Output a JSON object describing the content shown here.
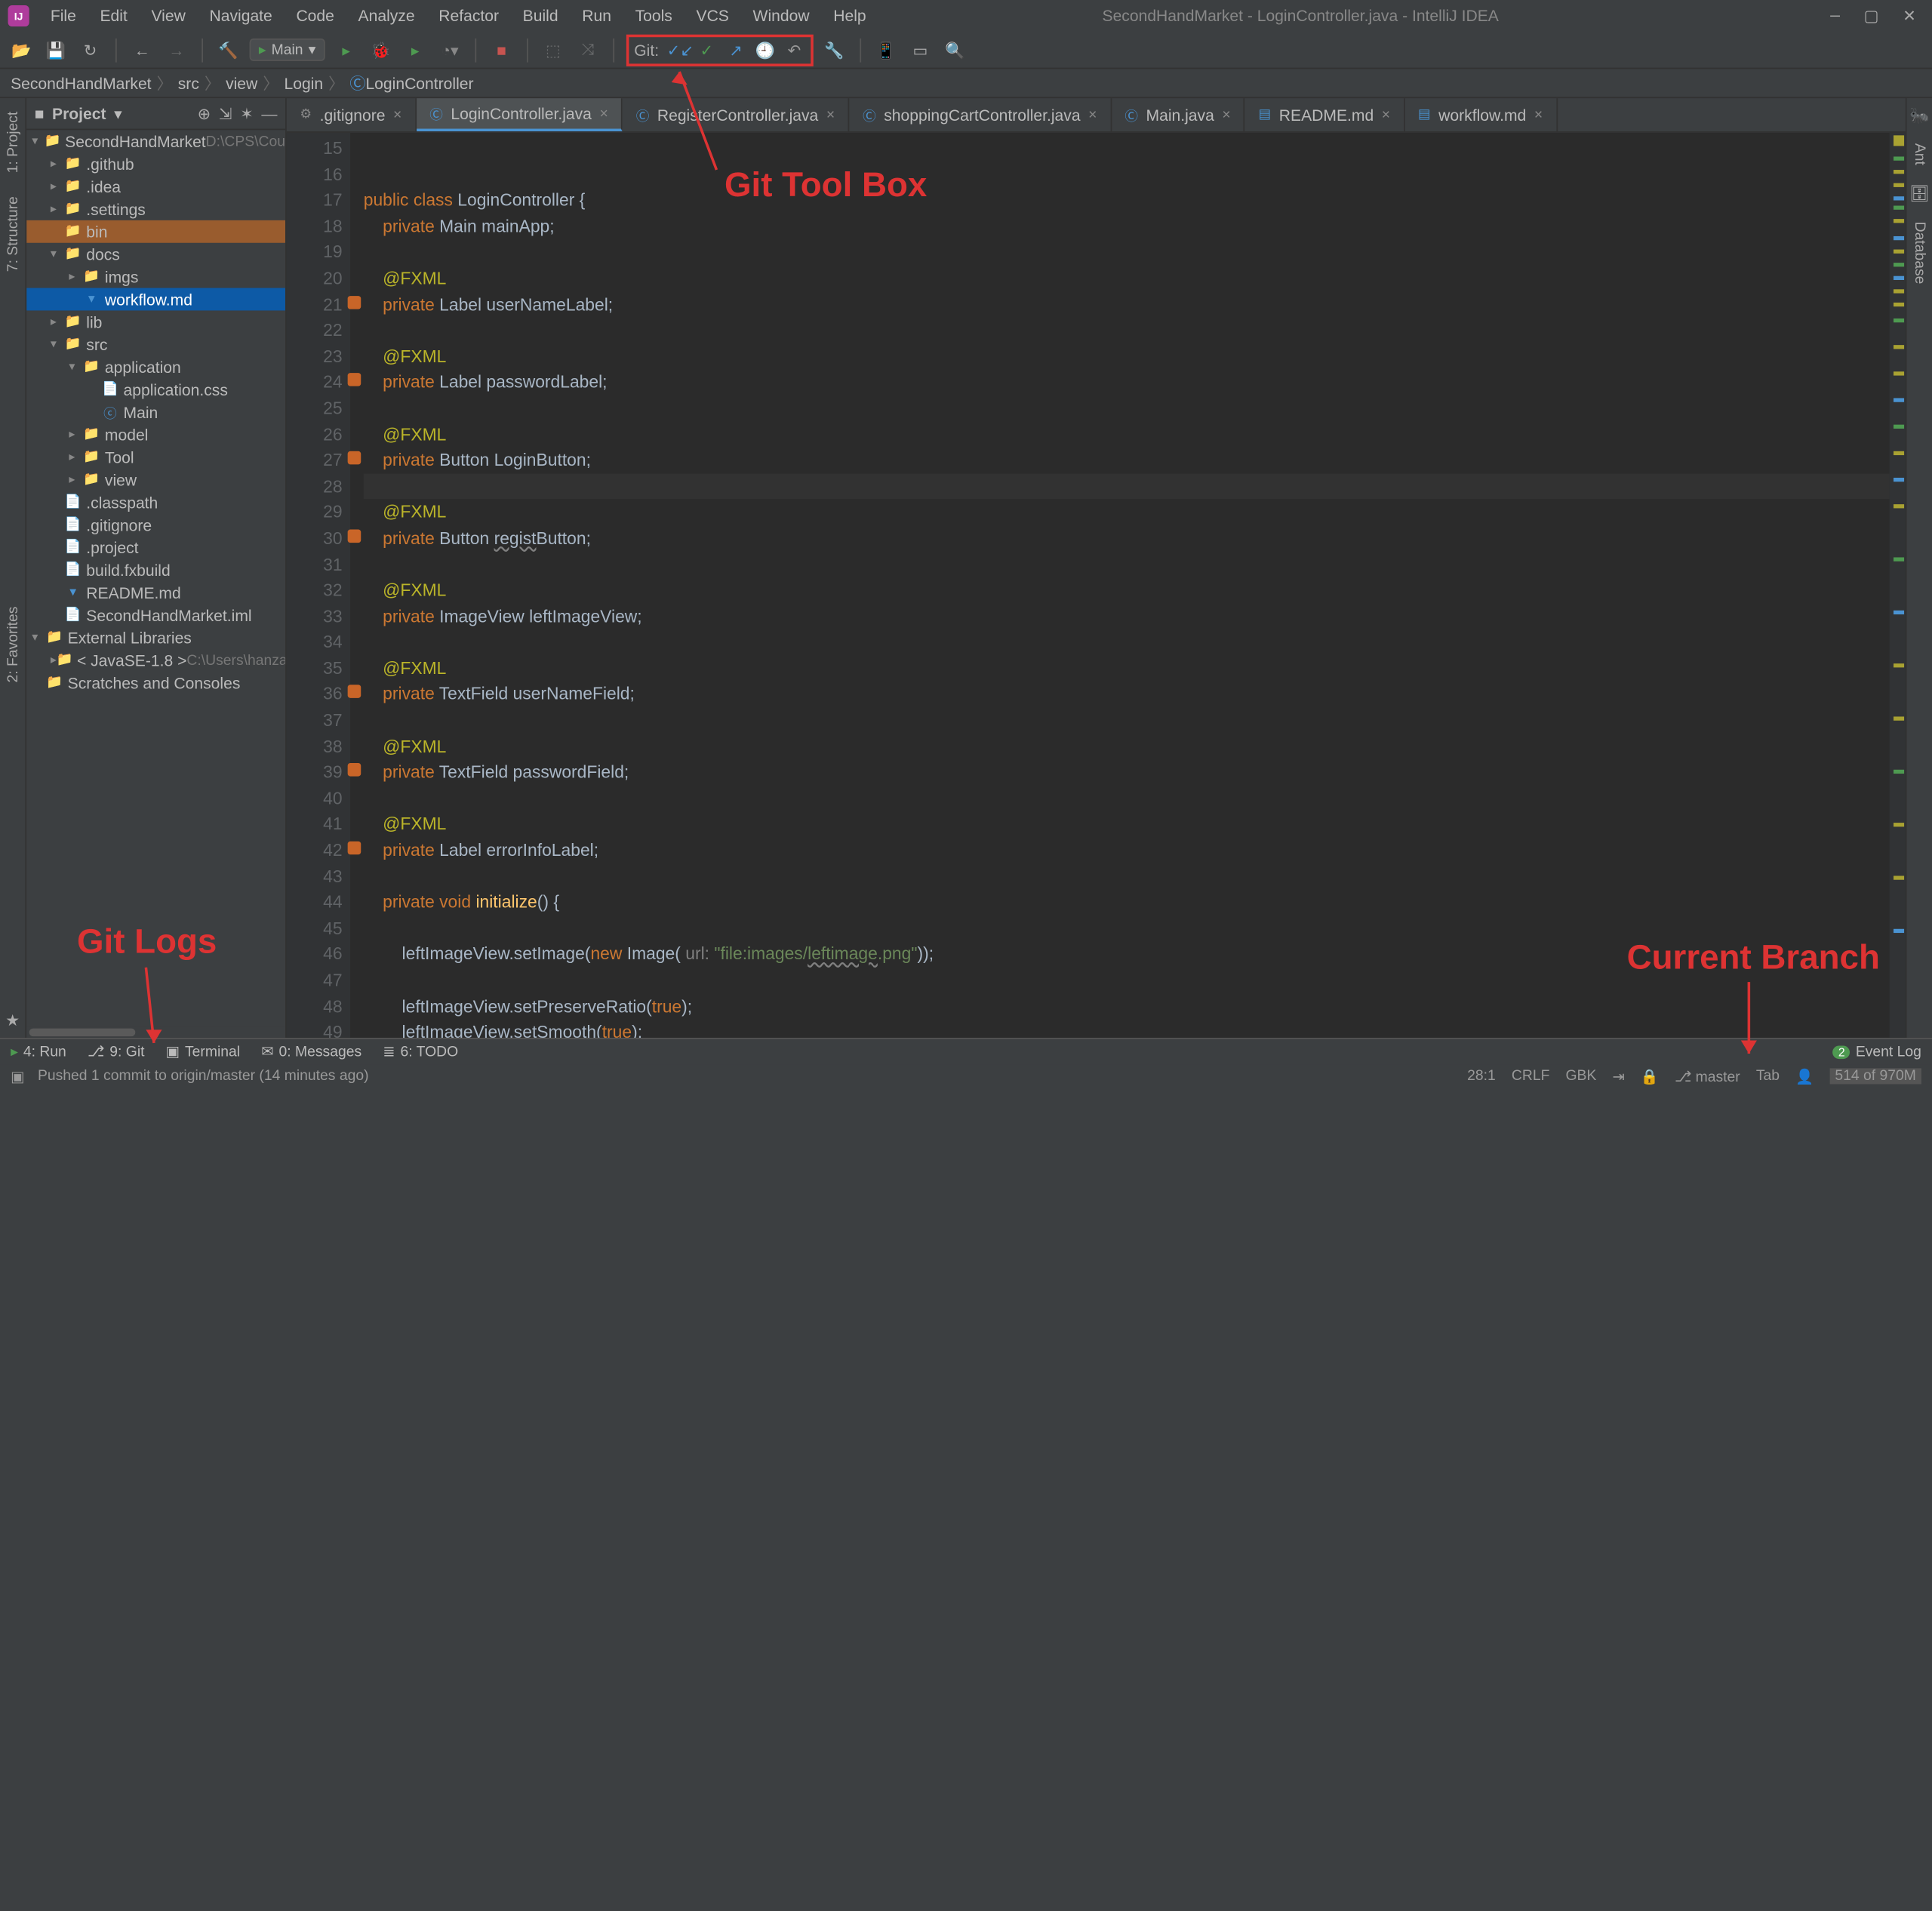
{
  "window": {
    "title": "SecondHandMarket - LoginController.java - IntelliJ IDEA"
  },
  "menu": [
    "File",
    "Edit",
    "View",
    "Navigate",
    "Code",
    "Analyze",
    "Refactor",
    "Build",
    "Run",
    "Tools",
    "VCS",
    "Window",
    "Help"
  ],
  "runconfig": "Main",
  "git_label": "Git:",
  "breadcrumbs": [
    "SecondHandMarket",
    "src",
    "view",
    "Login",
    "LoginController"
  ],
  "project_panel": {
    "title": "Project"
  },
  "tree": {
    "root": "SecondHandMarket",
    "root_path": "D:\\CPS\\Cou",
    "items": [
      {
        "d": 1,
        "a": "▸",
        "i": "ifolder2",
        "t": ".github"
      },
      {
        "d": 1,
        "a": "▸",
        "i": "ifolder",
        "t": ".idea",
        "cls": "idea"
      },
      {
        "d": 1,
        "a": "▸",
        "i": "ifolder2",
        "t": ".settings"
      },
      {
        "d": 1,
        "a": "",
        "i": "ifolder",
        "t": "bin",
        "sel": "selbin"
      },
      {
        "d": 1,
        "a": "▾",
        "i": "ifolder2",
        "t": "docs"
      },
      {
        "d": 2,
        "a": "▸",
        "i": "ifolder2",
        "t": "imgs"
      },
      {
        "d": 2,
        "a": "",
        "i": "imd",
        "t": "workflow.md",
        "sel": "sel"
      },
      {
        "d": 1,
        "a": "▸",
        "i": "ifolder",
        "t": "lib",
        "cls": "idea"
      },
      {
        "d": 1,
        "a": "▾",
        "i": "ifolder2",
        "t": "src"
      },
      {
        "d": 2,
        "a": "▾",
        "i": "ifolder2",
        "t": "application"
      },
      {
        "d": 3,
        "a": "",
        "i": "ifile",
        "t": "application.css"
      },
      {
        "d": 3,
        "a": "",
        "i": "ijava",
        "t": "Main"
      },
      {
        "d": 2,
        "a": "▸",
        "i": "ifolder2",
        "t": "model"
      },
      {
        "d": 2,
        "a": "▸",
        "i": "ifolder2",
        "t": "Tool"
      },
      {
        "d": 2,
        "a": "▸",
        "i": "ifolder2",
        "t": "view"
      },
      {
        "d": 1,
        "a": "",
        "i": "ifile",
        "t": ".classpath"
      },
      {
        "d": 1,
        "a": "",
        "i": "ifile",
        "t": ".gitignore"
      },
      {
        "d": 1,
        "a": "",
        "i": "ifile",
        "t": ".project"
      },
      {
        "d": 1,
        "a": "",
        "i": "ifile",
        "t": "build.fxbuild"
      },
      {
        "d": 1,
        "a": "",
        "i": "imd",
        "t": "README.md"
      },
      {
        "d": 1,
        "a": "",
        "i": "ifile",
        "t": "SecondHandMarket.iml"
      }
    ],
    "ext_lib": "External Libraries",
    "jdk": "< JavaSE-1.8 >",
    "jdk_path": "C:\\Users\\hanza",
    "scratches": "Scratches and Consoles"
  },
  "tabs": [
    {
      "icon": "⚙",
      "label": ".gitignore",
      "active": false,
      "color": "#888"
    },
    {
      "icon": "Ⓒ",
      "label": "LoginController.java",
      "active": true,
      "color": "#4a93d2"
    },
    {
      "icon": "Ⓒ",
      "label": "RegisterController.java",
      "active": false,
      "color": "#4a93d2"
    },
    {
      "icon": "Ⓒ",
      "label": "shoppingCartController.java",
      "active": false,
      "color": "#4a93d2"
    },
    {
      "icon": "Ⓒ",
      "label": "Main.java",
      "active": false,
      "color": "#4a93d2"
    },
    {
      "icon": "▤",
      "label": "README.md",
      "active": false,
      "color": "#4a93d2"
    },
    {
      "icon": "▤",
      "label": "workflow.md",
      "active": false,
      "color": "#4a93d2"
    }
  ],
  "code": {
    "start": 15,
    "lines": [
      {
        "n": 15,
        "h": ""
      },
      {
        "n": 16,
        "h": ""
      },
      {
        "n": 17,
        "h": "<span class='kw'>public class</span> <span class='type'>LoginController</span> {"
      },
      {
        "n": 18,
        "h": "    <span class='kw'>private</span> Main mainApp;"
      },
      {
        "n": 19,
        "h": ""
      },
      {
        "n": 20,
        "h": "    <span class='ann'>@FXML</span>"
      },
      {
        "n": 21,
        "h": "    <span class='kw'>private</span> Label userNameLabel;",
        "mark": true
      },
      {
        "n": 22,
        "h": ""
      },
      {
        "n": 23,
        "h": "    <span class='ann'>@FXML</span>"
      },
      {
        "n": 24,
        "h": "    <span class='kw'>private</span> Label passwordLabel;",
        "mark": true
      },
      {
        "n": 25,
        "h": ""
      },
      {
        "n": 26,
        "h": "    <span class='ann'>@FXML</span>"
      },
      {
        "n": 27,
        "h": "    <span class='kw'>private</span> Button LoginButton;",
        "mark": true
      },
      {
        "n": 28,
        "h": "",
        "cur": true
      },
      {
        "n": 29,
        "h": "    <span class='ann'>@FXML</span>"
      },
      {
        "n": 30,
        "h": "    <span class='kw'>private</span> Button <span class='under'>regist</span>Button;",
        "mark": true
      },
      {
        "n": 31,
        "h": ""
      },
      {
        "n": 32,
        "h": "    <span class='ann'>@FXML</span>"
      },
      {
        "n": 33,
        "h": "    <span class='kw'>private</span> ImageView leftImageView;"
      },
      {
        "n": 34,
        "h": ""
      },
      {
        "n": 35,
        "h": "    <span class='ann'>@FXML</span>"
      },
      {
        "n": 36,
        "h": "    <span class='kw'>private</span> TextField userNameField;",
        "mark": true
      },
      {
        "n": 37,
        "h": ""
      },
      {
        "n": 38,
        "h": "    <span class='ann'>@FXML</span>"
      },
      {
        "n": 39,
        "h": "    <span class='kw'>private</span> TextField passwordField;",
        "mark": true
      },
      {
        "n": 40,
        "h": ""
      },
      {
        "n": 41,
        "h": "    <span class='ann'>@FXML</span>"
      },
      {
        "n": 42,
        "h": "    <span class='kw'>private</span> Label errorInfoLabel;",
        "mark": true
      },
      {
        "n": 43,
        "h": ""
      },
      {
        "n": 44,
        "h": "    <span class='kw'>private void</span> <span class='fn'>initialize</span>() {"
      },
      {
        "n": 45,
        "h": ""
      },
      {
        "n": 46,
        "h": "        leftImageView.setImage(<span class='kw'>new</span> Image( <span class='param'>url:</span> <span class='str'>\"file:images/<span class='under'>leftimage</span>.png\"</span>));"
      },
      {
        "n": 47,
        "h": ""
      },
      {
        "n": 48,
        "h": "        leftImageView.setPreserveRatio(<span class='kw'>true</span>);"
      },
      {
        "n": 49,
        "h": "        leftImageView.setSmooth(<span class='kw'>true</span>);"
      }
    ]
  },
  "left_tabs": [
    "1: Project",
    "7: Structure",
    "2: Favorites"
  ],
  "right_tabs": [
    "Ant",
    "Database"
  ],
  "bottom": {
    "run": "4: Run",
    "git": "9: Git",
    "terminal": "Terminal",
    "messages": "0: Messages",
    "todo": "6: TODO",
    "eventlog": "Event Log",
    "eventcount": "2"
  },
  "status": {
    "msg": "Pushed 1 commit to origin/master (14 minutes ago)",
    "pos": "28:1",
    "le": "CRLF",
    "enc": "GBK",
    "branch": "master",
    "tab": "Tab",
    "mem": "514 of 970M"
  },
  "annotations": {
    "git_toolbox": "Git Tool Box",
    "git_logs": "Git Logs",
    "current_branch": "Current Branch"
  }
}
